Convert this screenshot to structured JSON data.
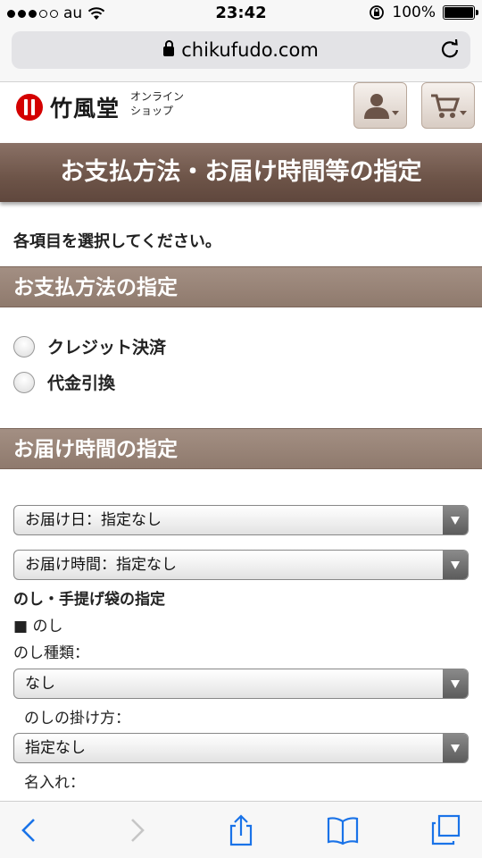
{
  "status_bar": {
    "carrier": "au",
    "time": "23:42",
    "battery": "100%"
  },
  "browser": {
    "url": "chikufudo.com"
  },
  "site": {
    "logo_text": "竹風堂",
    "shop_line1": "オンライン",
    "shop_line2": "ショップ"
  },
  "page": {
    "title": "お支払方法・お届け時間等の指定",
    "instruction": "各項目を選択してください。"
  },
  "payment": {
    "heading": "お支払方法の指定",
    "options": [
      "クレジット決済",
      "代金引換"
    ]
  },
  "delivery": {
    "heading": "お届け時間の指定",
    "date_select": "お届け日：指定なし",
    "time_select": "お届け時間：指定なし"
  },
  "noshi": {
    "heading": "のし・手提げ袋の指定",
    "bullet_label": "■ のし",
    "type_label": "のし種類：",
    "type_select": "なし",
    "method_label": "のしの掛け方：",
    "method_select": "指定なし",
    "name_label": "名入れ："
  },
  "colors": {
    "title_bar": "#6d5448",
    "section_bar": "#9a8679",
    "ios_blue": "#1a73e8"
  }
}
